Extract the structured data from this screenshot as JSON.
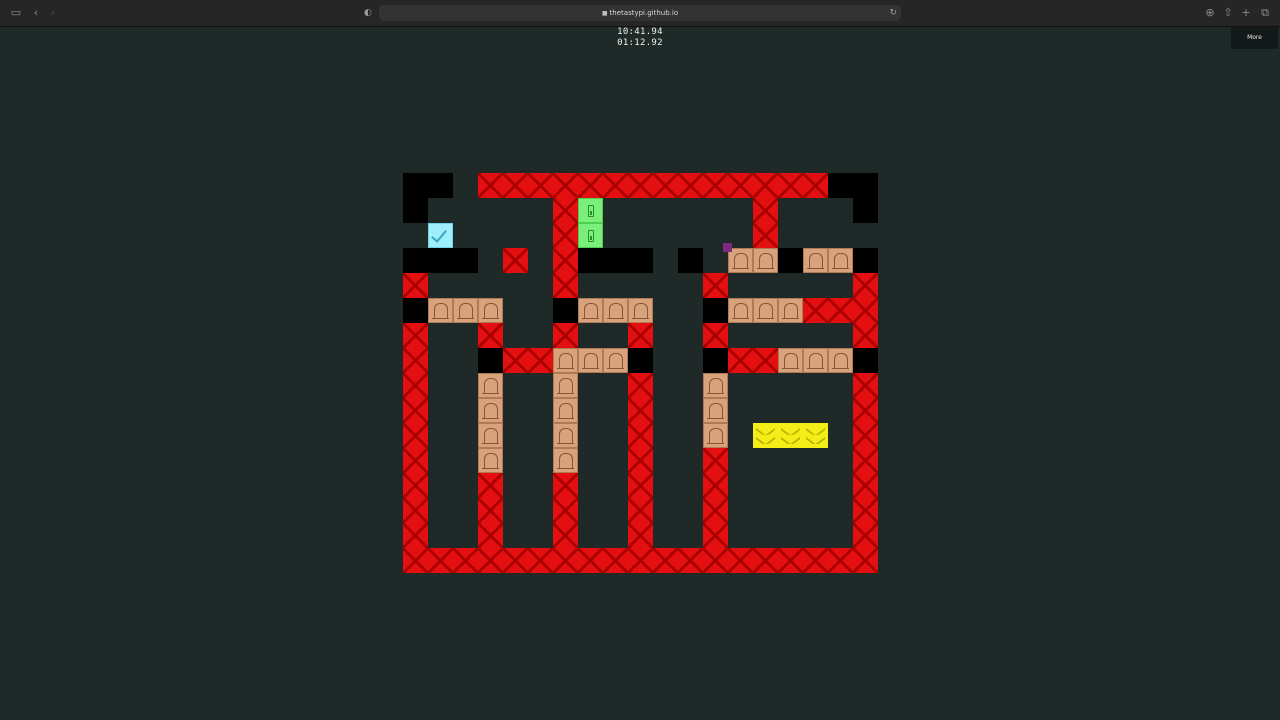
{
  "browser": {
    "url": "thetastypi.github.io",
    "sidebar_icon": "sidebar-icon",
    "back_icon": "chevron-left-icon",
    "forward_icon": "chevron-right-icon",
    "shield_icon": "shield-icon",
    "reload_icon": "reload-icon",
    "download_icon": "download-icon",
    "share_icon": "share-icon",
    "new_tab_icon": "plus-icon",
    "tabs_icon": "tabs-icon"
  },
  "game": {
    "timer_total": "10:41.94",
    "timer_level": "01:12.92",
    "more_label": "More",
    "colors": {
      "background": "#1f2a28",
      "red_wall": "#e40f10",
      "black_wall": "#000000",
      "crate": "#d7a27c",
      "goal": "#7aef7a",
      "yellow": "#f4ee18",
      "check": "#9feefc",
      "player": "#7e2a82"
    },
    "legend": {
      "R": "red-wall",
      "B": "black-wall",
      "C": "crate",
      "G": "goal",
      "Y": "yellow-block",
      "K": "checkmark-tile",
      ".": "floor"
    },
    "grid": [
      "BB.RRRRRRRRRRRRRRBB",
      "B.....RG......R...B",
      ".K....RG......R....",
      "BBB.R.RBBB.B.CCBCCB",
      "R.....R.....R.....R",
      "BCCC..BCCC..BCCCRRR",
      "R..R..R..R..R.....R",
      "R..BRRCCCB..BRRCCCB",
      "R..C..C..R..C.....R",
      "R..C..C..R..C.....R",
      "R..C..C..R..C.YYY.R",
      "R..C..C..R..R.....R",
      "R..R..R..R..R.....R",
      "R..R..R..R..R.....R",
      "R..R..R..R..R.....R",
      "RRRRRRRRRRRRRRRRRRR"
    ],
    "player": {
      "col": 12.8,
      "row": 2.8
    }
  }
}
